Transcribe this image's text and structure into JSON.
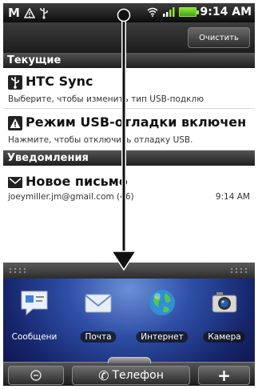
{
  "status_bar": {
    "time": "9:14 AM",
    "icons_left": [
      "gmail-icon",
      "warning-icon",
      "usb-icon"
    ],
    "icons_right": [
      "wifi-icon",
      "signal-icon",
      "battery-icon"
    ]
  },
  "clear_button": {
    "label": "Очистить"
  },
  "sections": {
    "current": {
      "title": "Текущие",
      "items": [
        {
          "title": "HTC Sync",
          "subtitle": "Выберите, чтобы изменить тип USB-подклю",
          "icon": "usb-icon"
        },
        {
          "title": "Режим USB-отладки включен",
          "subtitle": "Нажмите, чтобы отключить отладку USB.",
          "icon": "warning-icon"
        }
      ]
    },
    "notifications": {
      "title": "Уведомления",
      "items": [
        {
          "title": "Новое письмо",
          "subtitle": "joeymiller.jm@gmail.com (46)",
          "time": "9:14 AM",
          "icon": "mail-icon"
        }
      ]
    }
  },
  "dock": {
    "items": [
      {
        "label": "Сообщени",
        "icon": "messages-icon"
      },
      {
        "label": "Почта",
        "icon": "mail-icon"
      },
      {
        "label": "Интернет",
        "icon": "globe-icon"
      },
      {
        "label": "Камера",
        "icon": "camera-icon"
      }
    ]
  },
  "home_bar": {
    "phone_label": "Телефон",
    "left_icon": "all-apps-icon",
    "right_icon": "plus-icon"
  },
  "colors": {
    "section_header": "#2b2b2b",
    "battery": "#6ecf2a",
    "wallpaper": "#2e4ea6"
  }
}
